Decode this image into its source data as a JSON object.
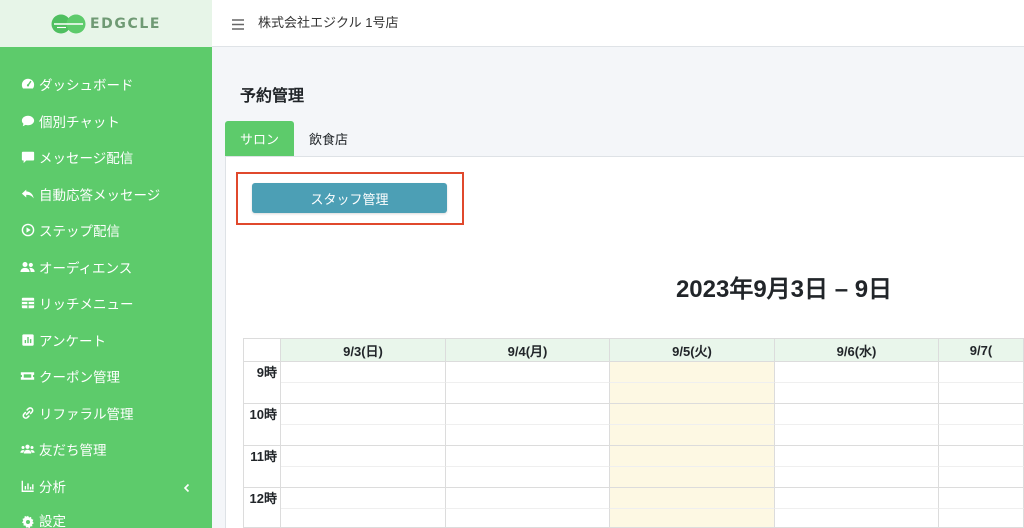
{
  "sidebar": {
    "logo_icon": "logo-icon",
    "logo_text": "EDGCLE",
    "items": [
      {
        "label": "ダッシュボード",
        "icon": "dashboard-icon"
      },
      {
        "label": "個別チャット",
        "icon": "chat-icon"
      },
      {
        "label": "メッセージ配信",
        "icon": "message-icon"
      },
      {
        "label": "自動応答メッセージ",
        "icon": "reply-icon"
      },
      {
        "label": "ステップ配信",
        "icon": "play-circle-icon"
      },
      {
        "label": "オーディエンス",
        "icon": "users-icon"
      },
      {
        "label": "リッチメニュー",
        "icon": "table-icon"
      },
      {
        "label": "アンケート",
        "icon": "poll-icon"
      },
      {
        "label": "クーポン管理",
        "icon": "ticket-icon"
      },
      {
        "label": "リファラル管理",
        "icon": "link-icon"
      },
      {
        "label": "友だち管理",
        "icon": "user-friends-icon"
      },
      {
        "label": "分析",
        "icon": "chart-bar-icon",
        "has_submenu": true,
        "submenu_icon": "chevron-left-icon"
      },
      {
        "label": "設定",
        "icon": "gear-icon"
      }
    ]
  },
  "header": {
    "menu_icon": "hamburger-icon",
    "store_name": "株式会社エジクル 1号店"
  },
  "page": {
    "title": "予約管理"
  },
  "tabs": [
    {
      "label": "サロン",
      "active": true
    },
    {
      "label": "飲食店",
      "active": false
    }
  ],
  "staff_button": {
    "label": "スタッフ管理"
  },
  "calendar": {
    "range_title": "2023年9月3日 – 9日",
    "days": [
      {
        "label": "9/3(日)",
        "today": false
      },
      {
        "label": "9/4(月)",
        "today": false
      },
      {
        "label": "9/5(火)",
        "today": true
      },
      {
        "label": "9/6(水)",
        "today": false
      },
      {
        "label": "9/7(",
        "today": false
      }
    ],
    "hours": [
      "9時",
      "10時",
      "11時",
      "12時"
    ]
  },
  "colors": {
    "sidebar_bg": "#5dcb6b",
    "logo_bar_bg": "#e7f5e8",
    "active_tab_bg": "#5dcb6b",
    "staff_button_bg": "#4c9fb5",
    "highlight_outline": "#e0482c",
    "day_header_bg": "#e9f6eb",
    "today_bg": "#fdf8e3"
  }
}
